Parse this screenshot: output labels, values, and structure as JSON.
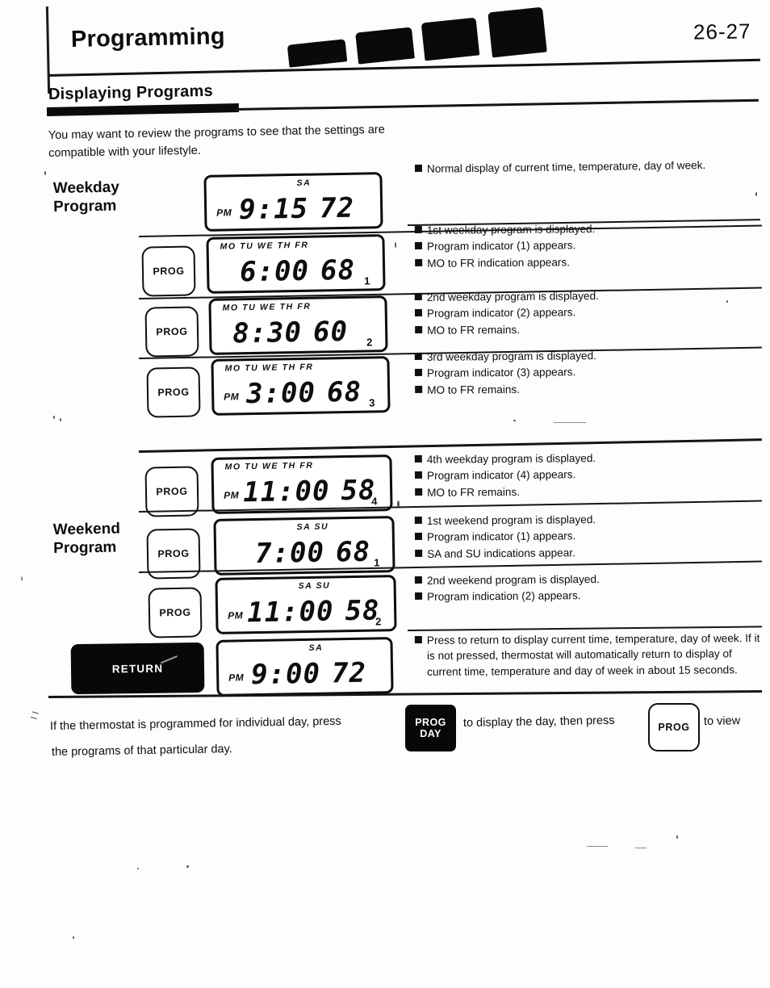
{
  "header": {
    "title": "Programming",
    "page_number": "26-27"
  },
  "section": {
    "heading": "Displaying Programs",
    "intro": "You may want to review the programs to see that the settings are compatible with your lifestyle."
  },
  "labels": {
    "weekday_program": "Weekday\nProgram",
    "weekend_program": "Weekend\nProgram"
  },
  "buttons": {
    "prog": "PROG",
    "return": "RETURN",
    "prog_day_line1": "PROG",
    "prog_day_line2": "DAY"
  },
  "rows": [
    {
      "button": null,
      "lcd": {
        "days": "SA",
        "ampm": "PM",
        "time": "9:15",
        "temp": "72",
        "prog_number": ""
      },
      "bullets": [
        "Normal display of current time, temperature, day of week."
      ]
    },
    {
      "button": "PROG",
      "lcd": {
        "days": "MO TU WE TH FR",
        "ampm": "",
        "time": "6:00",
        "temp": "68",
        "prog_number": "1"
      },
      "bullets": [
        "1st weekday program is displayed.",
        "Program indicator (1) appears.",
        "MO to FR indication appears."
      ]
    },
    {
      "button": "PROG",
      "lcd": {
        "days": "MO TU WE TH FR",
        "ampm": "",
        "time": "8:30",
        "temp": "60",
        "prog_number": "2"
      },
      "bullets": [
        "2nd weekday program is displayed.",
        "Program indicator (2) appears.",
        "MO to FR remains."
      ]
    },
    {
      "button": "PROG",
      "lcd": {
        "days": "MO TU WE TH FR",
        "ampm": "PM",
        "time": "3:00",
        "temp": "68",
        "prog_number": "3"
      },
      "bullets": [
        "3rd weekday program is displayed.",
        "Program indicator (3) appears.",
        "MO to FR remains."
      ]
    },
    {
      "button": "PROG",
      "lcd": {
        "days": "MO TU WE TH FR",
        "ampm": "PM",
        "time": "11:00",
        "temp": "58",
        "prog_number": "4"
      },
      "bullets": [
        "4th weekday program is displayed.",
        "Program indicator (4) appears.",
        "MO to FR remains."
      ]
    },
    {
      "button": "PROG",
      "lcd": {
        "days": "SA SU",
        "ampm": "",
        "time": "7:00",
        "temp": "68",
        "prog_number": "1"
      },
      "bullets": [
        "1st weekend program is displayed.",
        "Program indicator (1) appears.",
        "SA and SU indications appear."
      ]
    },
    {
      "button": "PROG",
      "lcd": {
        "days": "SA SU",
        "ampm": "PM",
        "time": "11:00",
        "temp": "58",
        "prog_number": "2"
      },
      "bullets": [
        "2nd weekend program is displayed.",
        "Program indication (2) appears."
      ]
    },
    {
      "button": "RETURN",
      "lcd": {
        "days": "SA",
        "ampm": "PM",
        "time": "9:00",
        "temp": "72",
        "prog_number": ""
      },
      "bullets": [
        "Press to return to display current time, temperature, day of week. If it is not pressed, thermostat will automatically return to display of current time, temperature and day of week in about 15 seconds."
      ]
    }
  ],
  "footer": {
    "part1": "If the thermostat is programmed for individual day, press",
    "part2": "to display the day, then press",
    "part3": "to view",
    "part4": "the programs of that particular day."
  }
}
